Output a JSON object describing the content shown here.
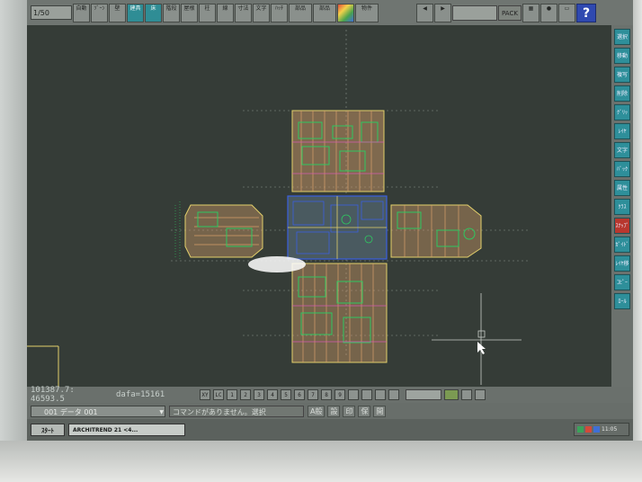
{
  "toolbar": {
    "scale": "1/50",
    "buttons": [
      {
        "label": "自動",
        "icon": "auto-icon"
      },
      {
        "label": "ｿﾞｰﾝ",
        "icon": "zone-icon"
      },
      {
        "label": "壁",
        "icon": "wall-icon"
      },
      {
        "label": "建具",
        "icon": "door-icon"
      },
      {
        "label": "床",
        "icon": "floor-icon"
      },
      {
        "label": "階段",
        "icon": "stairs-icon"
      },
      {
        "label": "屋根",
        "icon": "roof-icon"
      },
      {
        "label": "柱",
        "icon": "column-icon"
      },
      {
        "label": "線",
        "icon": "line-icon"
      },
      {
        "label": "寸法",
        "icon": "dimension-icon"
      },
      {
        "label": "文字",
        "icon": "text-icon"
      },
      {
        "label": "ﾊｯﾁ",
        "icon": "hatch-icon"
      },
      {
        "label": "部品",
        "icon": "parts-icon"
      },
      {
        "label": "部品",
        "icon": "parts-icon"
      },
      {
        "label": "物件",
        "icon": "property-icon"
      }
    ],
    "pack_label": "PACK",
    "help_label": "?"
  },
  "sidebar": {
    "buttons": [
      "選択",
      "移動",
      "複写",
      "削除",
      "ｸﾞﾘｯﾄﾞ",
      "ﾚｲﾔ",
      "文字",
      "ﾊﾞｯｸ",
      "属性",
      "ｸﾗｽ",
      "ｽﾅｯﾌﾟ",
      "ｶﾞｲﾄﾞ",
      "ﾚｲﾔ移動",
      "ｺﾋﾟｰ",
      "ﾛｰﾙ"
    ]
  },
  "status": {
    "coords": "101387.7: 46593.5",
    "delta": "dafa=15161",
    "buttons": [
      "XY",
      "LC",
      "1",
      "2",
      "3",
      "4",
      "5",
      "6",
      "7",
      "8",
      "9"
    ]
  },
  "cmdbar": {
    "layer": "001 データ 001",
    "message": "コマンドがありません。選択",
    "tools": [
      "A般",
      "設",
      "印",
      "保",
      "開"
    ]
  },
  "taskbar": {
    "start": "ｽﾀｰﾄ",
    "app": "ARCHITREND 21 <4...",
    "clock": "11:05"
  },
  "colors": {
    "canvas": "#353c37",
    "plan_yellow": "#e2cf6b",
    "plan_green": "#2fc860",
    "plan_blue": "#3a5fe0",
    "plan_magenta": "#d45bb0",
    "plan_wood": "#d9a06a"
  }
}
